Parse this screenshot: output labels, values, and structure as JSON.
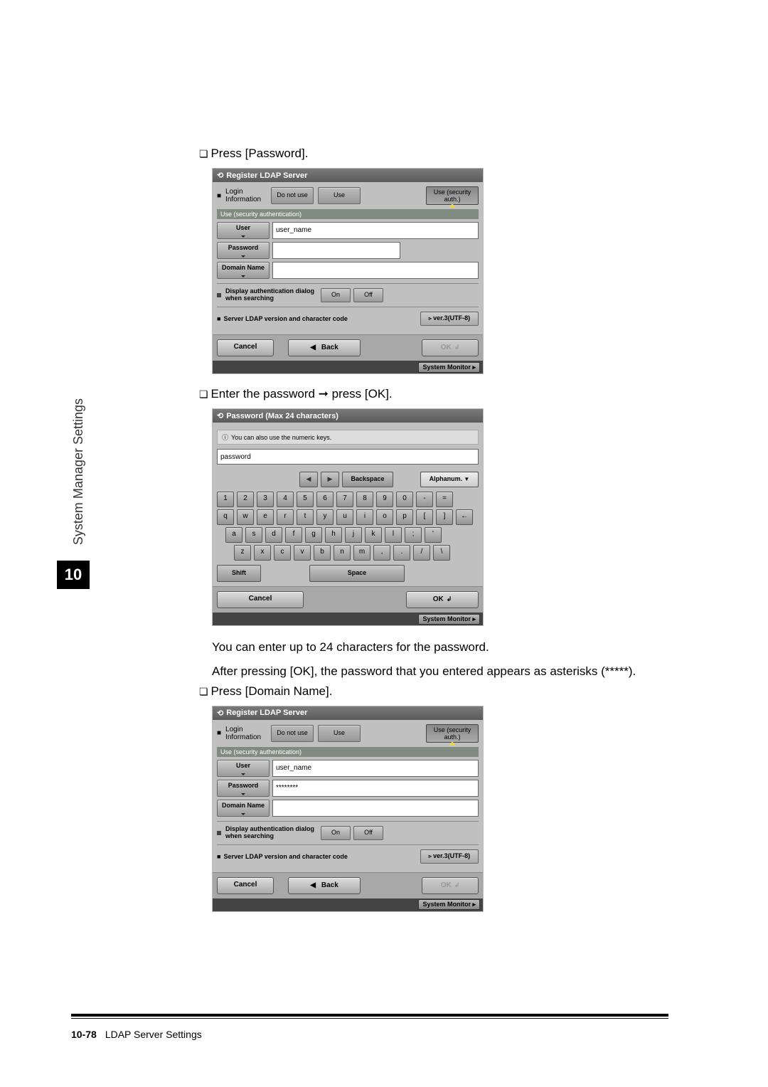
{
  "sidebar_label": "System Manager Settings",
  "chapter_number": "10",
  "steps": {
    "s1": "Press [Password].",
    "s2": "Enter the password ➞ press [OK].",
    "s3": "Press [Domain Name]."
  },
  "notes": {
    "n1": "You can enter up to 24 characters for the password.",
    "n2": "After pressing [OK], the password that you entered appears as asterisks (*****)."
  },
  "ldap": {
    "title": "Register LDAP Server",
    "login_label": "Login Information",
    "bullet": "■",
    "do_not_use": "Do not use",
    "use": "Use",
    "use_security": "Use (security auth.)",
    "greenbar": "Use (security authentication)",
    "user_btn": "User",
    "user_val": "user_name",
    "password_btn": "Password",
    "password_masked": "********",
    "domain_btn": "Domain Name",
    "auth_label": "Display authentication dialog when searching",
    "on": "On",
    "off": "Off",
    "version_label": "Server LDAP version and character code",
    "version_val": "ver.3(UTF-8)",
    "cancel": "Cancel",
    "back": "Back",
    "ok": "OK",
    "sysmon": "System Monitor"
  },
  "kb": {
    "title": "Password (Max 24 characters)",
    "tip": "You can also use the numeric keys.",
    "value": "password",
    "backspace": "Backspace",
    "mode": "Alphanum.",
    "shift": "Shift",
    "space": "Space",
    "cancel": "Cancel",
    "ok": "OK",
    "sysmon": "System Monitor",
    "row1": [
      "1",
      "2",
      "3",
      "4",
      "5",
      "6",
      "7",
      "8",
      "9",
      "0",
      "-",
      "="
    ],
    "row2": [
      "q",
      "w",
      "e",
      "r",
      "t",
      "y",
      "u",
      "i",
      "o",
      "p",
      "[",
      "]",
      "←"
    ],
    "row3": [
      "a",
      "s",
      "d",
      "f",
      "g",
      "h",
      "j",
      "k",
      "l",
      ";",
      "'"
    ],
    "row4": [
      "z",
      "x",
      "c",
      "v",
      "b",
      "n",
      "m",
      ",",
      ".",
      "/",
      "\\"
    ]
  },
  "footer": {
    "pagenum": "10-78",
    "title": "LDAP Server Settings"
  }
}
